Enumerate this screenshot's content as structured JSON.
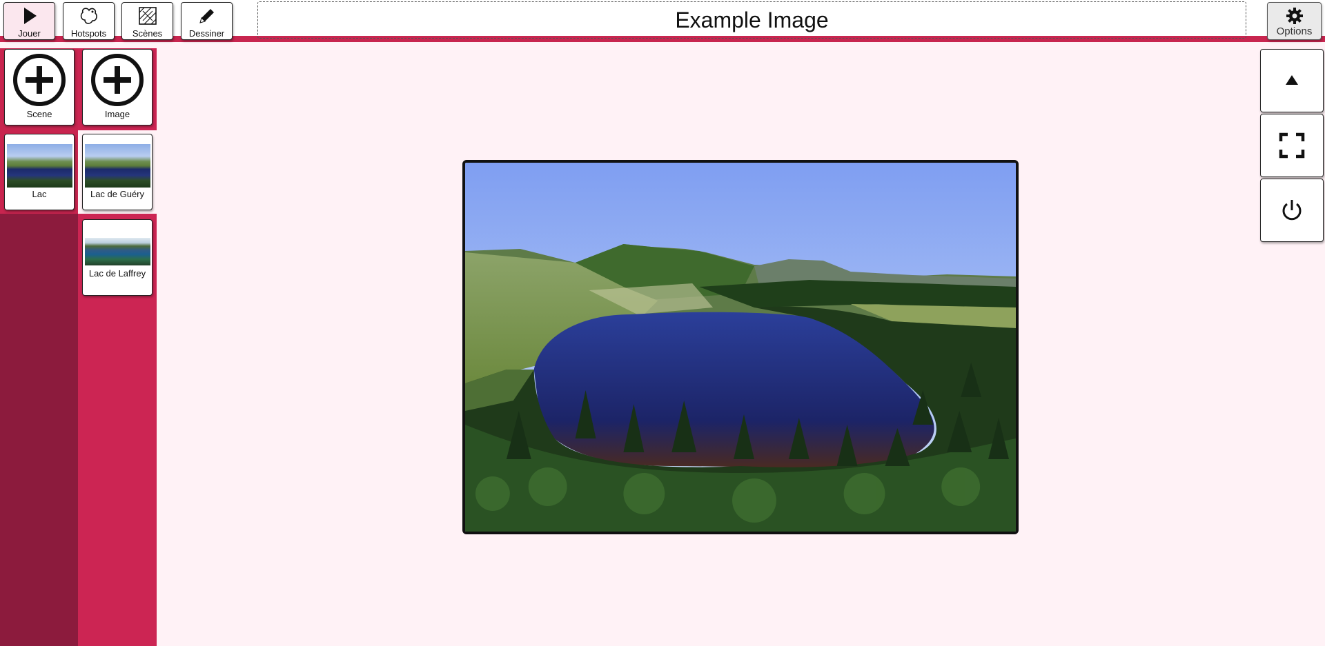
{
  "toolbar": {
    "play_label": "Jouer",
    "hotspots_label": "Hotspots",
    "scenes_label": "Scènes",
    "draw_label": "Dessiner",
    "options_label": "Options",
    "title": "Example Image"
  },
  "scenes_column": {
    "add_label": "Scene",
    "items": [
      {
        "label": "Lac"
      }
    ]
  },
  "images_column": {
    "add_label": "Image",
    "items": [
      {
        "label": "Lac de Guéry"
      },
      {
        "label": "Lac de Laffrey"
      }
    ]
  },
  "icons": {
    "play": "play-icon",
    "hotspots": "hotspot-shape-icon",
    "scenes": "scenes-icon",
    "draw": "pencil-icon",
    "options": "gear-icon",
    "add": "plus-circle-icon",
    "up": "triangle-up-icon",
    "fullscreen": "fullscreen-icon",
    "power": "power-icon"
  },
  "colors": {
    "accent": "#c8254f",
    "dark_accent": "#8c1b3d",
    "background": "#fff2f6"
  }
}
